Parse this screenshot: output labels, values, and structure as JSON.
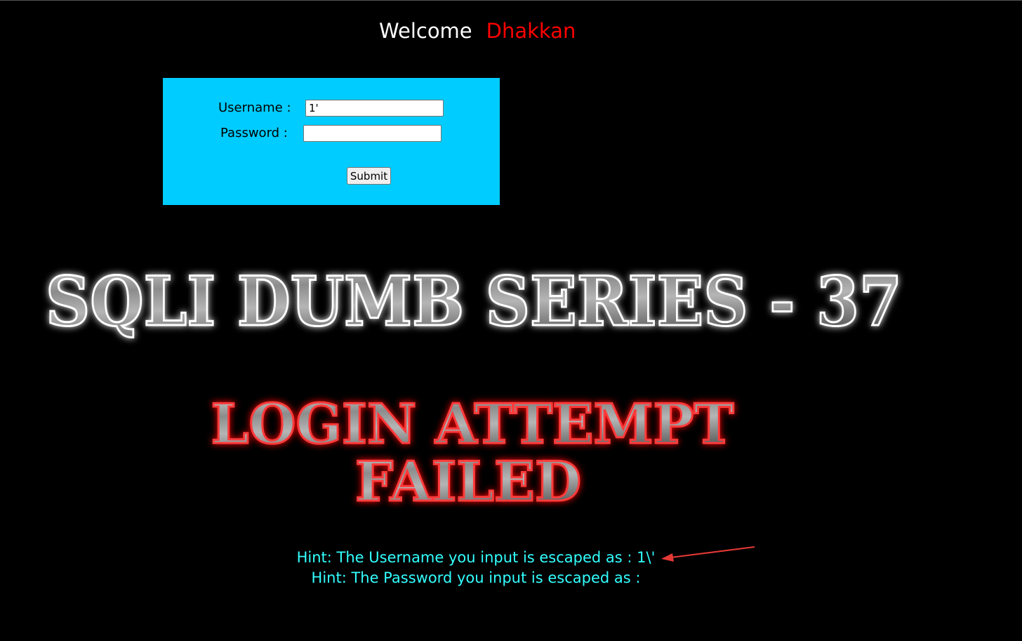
{
  "header": {
    "welcome": "Welcome",
    "name": "Dhakkan"
  },
  "login_form": {
    "username_label": "Username :",
    "username_value": "1'",
    "password_label": "Password :",
    "password_value": "",
    "submit_label": "Submit"
  },
  "banners": {
    "series_title": "SQLI DUMB SERIES - 37",
    "result_line1": "LOGIN ATTEMPT",
    "result_line2": "FAILED"
  },
  "hints": {
    "username_hint": "Hint: The Username you input is escaped as : 1\\'",
    "password_hint": "Hint: The Password you input is escaped as :"
  },
  "colors": {
    "background": "#000000",
    "form_background": "#00ccff",
    "name_accent": "#ff0000",
    "hint_text": "#33ffff",
    "annotation_arrow": "#e53935"
  }
}
